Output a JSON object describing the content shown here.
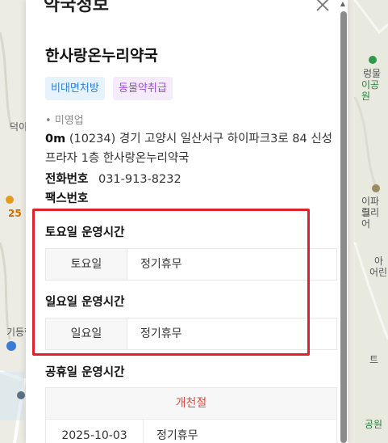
{
  "header": {
    "title": "약국정보"
  },
  "pharmacy": {
    "name": "한사랑온누리약국",
    "badges": [
      "비대면처방",
      "동물약취급"
    ],
    "status": "미영업",
    "distance": "0m",
    "address": "(10234) 경기 고양시 일산서구 하이파크3로 84 신성프라자 1층 한사랑온누리약국",
    "phone_label": "전화번호",
    "phone": "031-913-8232",
    "fax_label": "팩스번호"
  },
  "saturday": {
    "title": "토요일 운영시간",
    "day": "토요일",
    "value": "정기휴무"
  },
  "sunday": {
    "title": "일요일 운영시간",
    "day": "일요일",
    "value": "정기휴무"
  },
  "holiday": {
    "title": "공휴일 운영시간",
    "name": "개천절",
    "date": "2025-10-03",
    "value": "정기휴무"
  },
  "map_labels": {
    "l1": "덕이",
    "l2": "25",
    "l3": "기등핵",
    "r1": "렁물",
    "r2": "이공원",
    "r3": "이파크",
    "r4": "릴리어",
    "r5": "아",
    "r6": "어린",
    "r7": "트",
    "r8": "공원"
  },
  "colors": {
    "highlight": "#e0212a",
    "badge_blue": "#2f7ed8",
    "badge_purple": "#9a4bd3",
    "holiday_red": "#e2483a"
  }
}
